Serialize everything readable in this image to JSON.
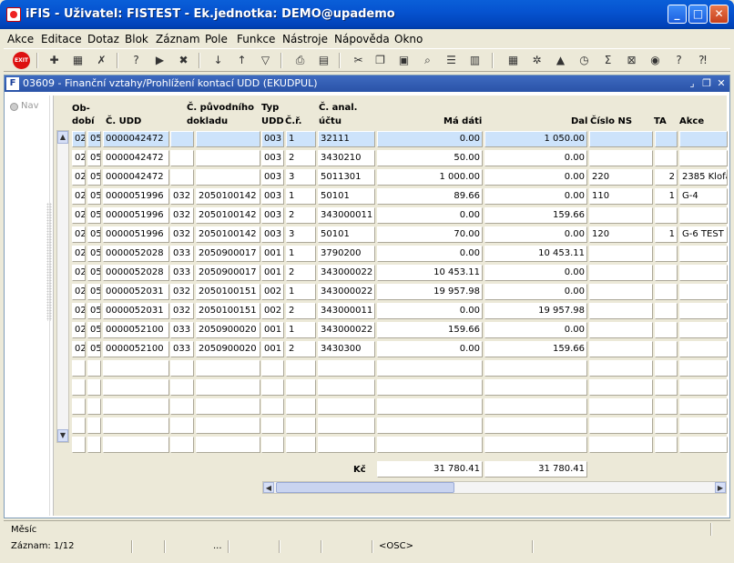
{
  "window": {
    "title": "iFIS - Uživatel: FISTEST - Ek.jednotka: DEMO@upademo",
    "minimize": "_",
    "maximize": "□",
    "close": "✕"
  },
  "menu": [
    "Akce",
    "Editace",
    "Dotaz",
    "Blok",
    "Záznam",
    "Pole",
    "Funkce",
    "Nástroje",
    "Nápověda",
    "Okno"
  ],
  "toolbar": {
    "exit": "EXIT",
    "icons": [
      "new-record-icon",
      "save-icon",
      "delete-record-icon",
      "query-icon",
      "execute-query-icon",
      "cancel-query-icon",
      "sort-asc-icon",
      "sort-desc-icon",
      "filter-icon",
      "print-icon",
      "print-preview-icon",
      "cut-icon",
      "copy-icon",
      "paste-icon",
      "find-icon",
      "list-icon",
      "columns-icon",
      "calculator-icon",
      "settings-icon",
      "chart-icon",
      "clock-icon",
      "sum-icon",
      "excel-icon",
      "browser-icon",
      "help-icon",
      "context-help-icon"
    ]
  },
  "form": {
    "title": "03609 - Finanční vztahy/Prohlížení kontací UDD (EKUDPUL)",
    "nav": "Nav"
  },
  "grid": {
    "headers": {
      "obdobi_line1": "Ob-",
      "obdobi_line2": "dobí",
      "cudd": "Č. UDD",
      "puvodni_line1": "Č. původního",
      "puvodni_line2": "dokladu",
      "typ_line1": "Typ",
      "typ_line2": "UDD",
      "cr": "Č.ř.",
      "anal_line1": "Č. anal.",
      "anal_line2": "účtu",
      "madati": "Má dáti",
      "dal": "Dal",
      "cislons": "Číslo NS",
      "ta": "TA",
      "akce": "Akce"
    },
    "rows": [
      [
        "02",
        "05",
        "0000042472",
        "",
        "",
        "003",
        "1",
        "32111",
        "0.00",
        "1 050.00",
        "",
        "",
        ""
      ],
      [
        "02",
        "05",
        "0000042472",
        "",
        "",
        "003",
        "2",
        "3430210",
        "50.00",
        "0.00",
        "",
        "",
        ""
      ],
      [
        "02",
        "05",
        "0000042472",
        "",
        "",
        "003",
        "3",
        "5011301",
        "1 000.00",
        "0.00",
        "220",
        "2",
        "2385 Klofá"
      ],
      [
        "02",
        "05",
        "0000051996",
        "032",
        "2050100142",
        "003",
        "1",
        "50101",
        "89.66",
        "0.00",
        "110",
        "1",
        "G-4"
      ],
      [
        "02",
        "05",
        "0000051996",
        "032",
        "2050100142",
        "003",
        "2",
        "343000011",
        "0.00",
        "159.66",
        "",
        "",
        ""
      ],
      [
        "02",
        "05",
        "0000051996",
        "032",
        "2050100142",
        "003",
        "3",
        "50101",
        "70.00",
        "0.00",
        "120",
        "1",
        "G-6 TEST"
      ],
      [
        "02",
        "05",
        "0000052028",
        "033",
        "2050900017",
        "001",
        "1",
        "3790200",
        "0.00",
        "10 453.11",
        "",
        "",
        ""
      ],
      [
        "02",
        "05",
        "0000052028",
        "033",
        "2050900017",
        "001",
        "2",
        "343000022",
        "10 453.11",
        "0.00",
        "",
        "",
        ""
      ],
      [
        "02",
        "05",
        "0000052031",
        "032",
        "2050100151",
        "002",
        "1",
        "343000022",
        "19 957.98",
        "0.00",
        "",
        "",
        ""
      ],
      [
        "02",
        "05",
        "0000052031",
        "032",
        "2050100151",
        "002",
        "2",
        "343000011",
        "0.00",
        "19 957.98",
        "",
        "",
        ""
      ],
      [
        "02",
        "05",
        "0000052100",
        "033",
        "2050900020",
        "001",
        "1",
        "343000022",
        "159.66",
        "0.00",
        "",
        "",
        ""
      ],
      [
        "02",
        "05",
        "0000052100",
        "033",
        "2050900020",
        "001",
        "2",
        "3430300",
        "0.00",
        "159.66",
        "",
        "",
        ""
      ],
      [
        "",
        "",
        "",
        "",
        "",
        "",
        "",
        "",
        "",
        "",
        "",
        "",
        ""
      ],
      [
        "",
        "",
        "",
        "",
        "",
        "",
        "",
        "",
        "",
        "",
        "",
        "",
        ""
      ],
      [
        "",
        "",
        "",
        "",
        "",
        "",
        "",
        "",
        "",
        "",
        "",
        "",
        ""
      ],
      [
        "",
        "",
        "",
        "",
        "",
        "",
        "",
        "",
        "",
        "",
        "",
        "",
        ""
      ],
      [
        "",
        "",
        "",
        "",
        "",
        "",
        "",
        "",
        "",
        "",
        "",
        "",
        ""
      ]
    ],
    "total_label": "Kč",
    "total_madati": "31 780.41",
    "total_dal": "31 780.41"
  },
  "status": {
    "hint": "Měsíc",
    "record": "Záznam: 1/12",
    "ellipsis": "...",
    "osc": "<OSC>"
  }
}
